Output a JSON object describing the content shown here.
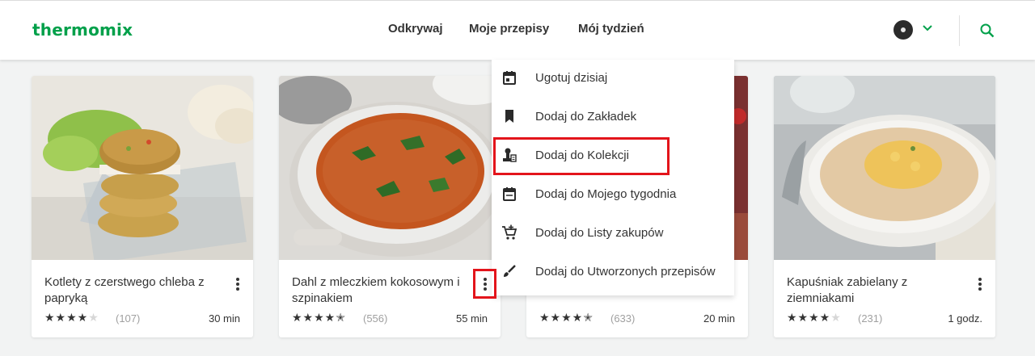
{
  "header": {
    "logo": "thermomix",
    "nav": [
      "Odkrywaj",
      "Moje przepisy",
      "Mój tydzień"
    ]
  },
  "icons": {
    "search": "search-icon",
    "chevron": "chevron-down-icon",
    "more": "more-vert-icon"
  },
  "cards": [
    {
      "title": "Kotlety z czerstwego chleba z papryką",
      "rating": 4,
      "count": "(107)",
      "time": "30 min"
    },
    {
      "title": "Dahl z mleczkiem kokosowym i szpinakiem",
      "rating": 4.5,
      "count": "(556)",
      "time": "55 min"
    },
    {
      "title": "",
      "rating": 4.5,
      "count": "(633)",
      "time": "20 min"
    },
    {
      "title": "Kapuśniak zabielany z ziemniakami",
      "rating": 4,
      "count": "(231)",
      "time": "1 godz."
    }
  ],
  "menu": {
    "items": [
      {
        "label": "Ugotuj dzisiaj",
        "icon": "calendar-today-icon"
      },
      {
        "label": "Dodaj do Zakładek",
        "icon": "bookmark-icon"
      },
      {
        "label": "Dodaj do Kolekcji",
        "icon": "collection-icon"
      },
      {
        "label": "Dodaj do Mojego tygodnia",
        "icon": "calendar-week-icon"
      },
      {
        "label": "Dodaj do Listy zakupów",
        "icon": "add-to-cart-icon"
      },
      {
        "label": "Dodaj do Utworzonych przepisów",
        "icon": "brush-icon"
      }
    ]
  },
  "colors": {
    "brand": "#00a04a",
    "highlight": "#e3141b",
    "text": "#343434",
    "muted": "#a0a0a0"
  }
}
